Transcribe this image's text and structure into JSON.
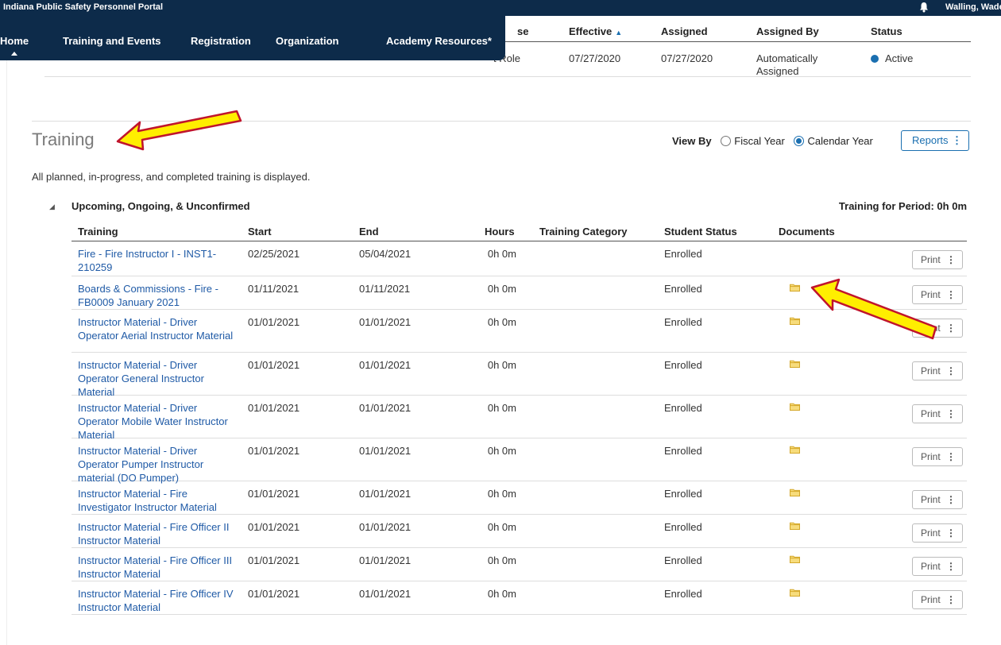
{
  "header": {
    "portal_title": "Indiana Public Safety Personnel Portal",
    "user_name": "Walling, Wade E.",
    "user_caret": "▾"
  },
  "nav": {
    "items": [
      "Home",
      "Training and Events",
      "Registration",
      "Organization",
      "Academy Resources*"
    ]
  },
  "role_table": {
    "headers": [
      "se",
      "Effective",
      "Assigned",
      "Assigned By",
      "Status"
    ],
    "sort_indicator": "▲",
    "row": {
      "type": "t Role",
      "effective": "07/27/2020",
      "assigned": "07/27/2020",
      "assigned_by_line1": "Automatically",
      "assigned_by_line2": "Assigned",
      "status": "Active"
    }
  },
  "training": {
    "title": "Training",
    "view_by_label": "View By",
    "view_options": [
      "Fiscal Year",
      "Calendar Year"
    ],
    "view_selected": "Calendar Year",
    "reports_label": "Reports",
    "kebab": "⋮",
    "info": "All planned, in-progress, and completed training is displayed.",
    "group_toggle": "◢",
    "group_title": "Upcoming, Ongoing, & Unconfirmed",
    "period_total": "Training for Period: 0h 0m",
    "columns": [
      "Training",
      "Start",
      "End",
      "Hours",
      "Training Category",
      "Student Status",
      "Documents"
    ],
    "print_label": "Print",
    "rows": [
      {
        "training": "Fire - Fire Instructor I - INST1-210259",
        "start": "02/25/2021",
        "end": "05/04/2021",
        "hours": "0h 0m",
        "category": "",
        "status": "Enrolled",
        "has_document": false
      },
      {
        "training": "Boards & Commissions - Fire - FB0009 January 2021",
        "start": "01/11/2021",
        "end": "01/11/2021",
        "hours": "0h 0m",
        "category": "",
        "status": "Enrolled",
        "has_document": true
      },
      {
        "training": "Instructor Material - Driver Operator Aerial Instructor Material",
        "start": "01/01/2021",
        "end": "01/01/2021",
        "hours": "0h 0m",
        "category": "",
        "status": "Enrolled",
        "has_document": true
      },
      {
        "training": "Instructor Material - Driver Operator General Instructor Material",
        "start": "01/01/2021",
        "end": "01/01/2021",
        "hours": "0h 0m",
        "category": "",
        "status": "Enrolled",
        "has_document": true
      },
      {
        "training": "Instructor Material - Driver Operator Mobile Water Instructor Material",
        "start": "01/01/2021",
        "end": "01/01/2021",
        "hours": "0h 0m",
        "category": "",
        "status": "Enrolled",
        "has_document": true
      },
      {
        "training": "Instructor Material - Driver Operator Pumper Instructor material (DO Pumper)",
        "start": "01/01/2021",
        "end": "01/01/2021",
        "hours": "0h 0m",
        "category": "",
        "status": "Enrolled",
        "has_document": true
      },
      {
        "training": "Instructor Material - Fire Investigator Instructor Material",
        "start": "01/01/2021",
        "end": "01/01/2021",
        "hours": "0h 0m",
        "category": "",
        "status": "Enrolled",
        "has_document": true
      },
      {
        "training": "Instructor Material - Fire Officer II Instructor Material",
        "start": "01/01/2021",
        "end": "01/01/2021",
        "hours": "0h 0m",
        "category": "",
        "status": "Enrolled",
        "has_document": true
      },
      {
        "training": "Instructor Material - Fire Officer III Instructor Material",
        "start": "01/01/2021",
        "end": "01/01/2021",
        "hours": "0h 0m",
        "category": "",
        "status": "Enrolled",
        "has_document": true
      },
      {
        "training": "Instructor Material - Fire Officer IV Instructor Material",
        "start": "01/01/2021",
        "end": "01/01/2021",
        "hours": "0h 0m",
        "category": "",
        "status": "Enrolled",
        "has_document": true
      }
    ]
  },
  "colors": {
    "nav_bg": "#0d2b4a",
    "link": "#1f5aa6",
    "accent": "#1a6fb0",
    "folder": "#f2c744",
    "annotation_arrow": "#ffee00",
    "annotation_outline": "#c0142c"
  },
  "icons": {
    "bell": "bell-icon",
    "folder": "folder-icon",
    "arrow": "annotation-arrow"
  }
}
